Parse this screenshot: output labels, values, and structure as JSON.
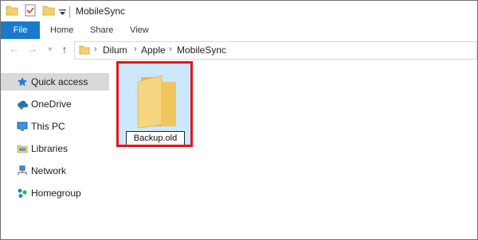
{
  "window": {
    "title": "MobileSync",
    "quick_access_toolbar": [
      "folder-icon",
      "properties-icon",
      "new-folder-icon",
      "customize-dropdown-icon"
    ]
  },
  "ribbon": {
    "tabs": [
      {
        "label": "File",
        "active": true
      },
      {
        "label": "Home"
      },
      {
        "label": "Share"
      },
      {
        "label": "View"
      }
    ]
  },
  "address_bar": {
    "nav_buttons": [
      "back-icon",
      "forward-icon",
      "recent-dropdown-icon",
      "up-icon"
    ],
    "breadcrumb": [
      "Dilum",
      "Apple",
      "MobileSync"
    ],
    "separator": "›"
  },
  "nav_pane": {
    "items": [
      {
        "label": "Quick access",
        "icon": "star-icon",
        "selected": true
      },
      {
        "label": "OneDrive",
        "icon": "onedrive-cloud-icon"
      },
      {
        "label": "This PC",
        "icon": "computer-icon"
      },
      {
        "label": "Libraries",
        "icon": "libraries-icon"
      },
      {
        "label": "Network",
        "icon": "network-icon"
      },
      {
        "label": "Homegroup",
        "icon": "homegroup-icon"
      }
    ]
  },
  "content": {
    "items": [
      {
        "name": "Backup.old",
        "type": "folder",
        "state": "renaming",
        "highlighted": true
      }
    ]
  },
  "colors": {
    "file_tab": "#1979ca",
    "selection": "#cce8ff",
    "highlight": "#e3141c",
    "folder": "#f4d16b"
  }
}
